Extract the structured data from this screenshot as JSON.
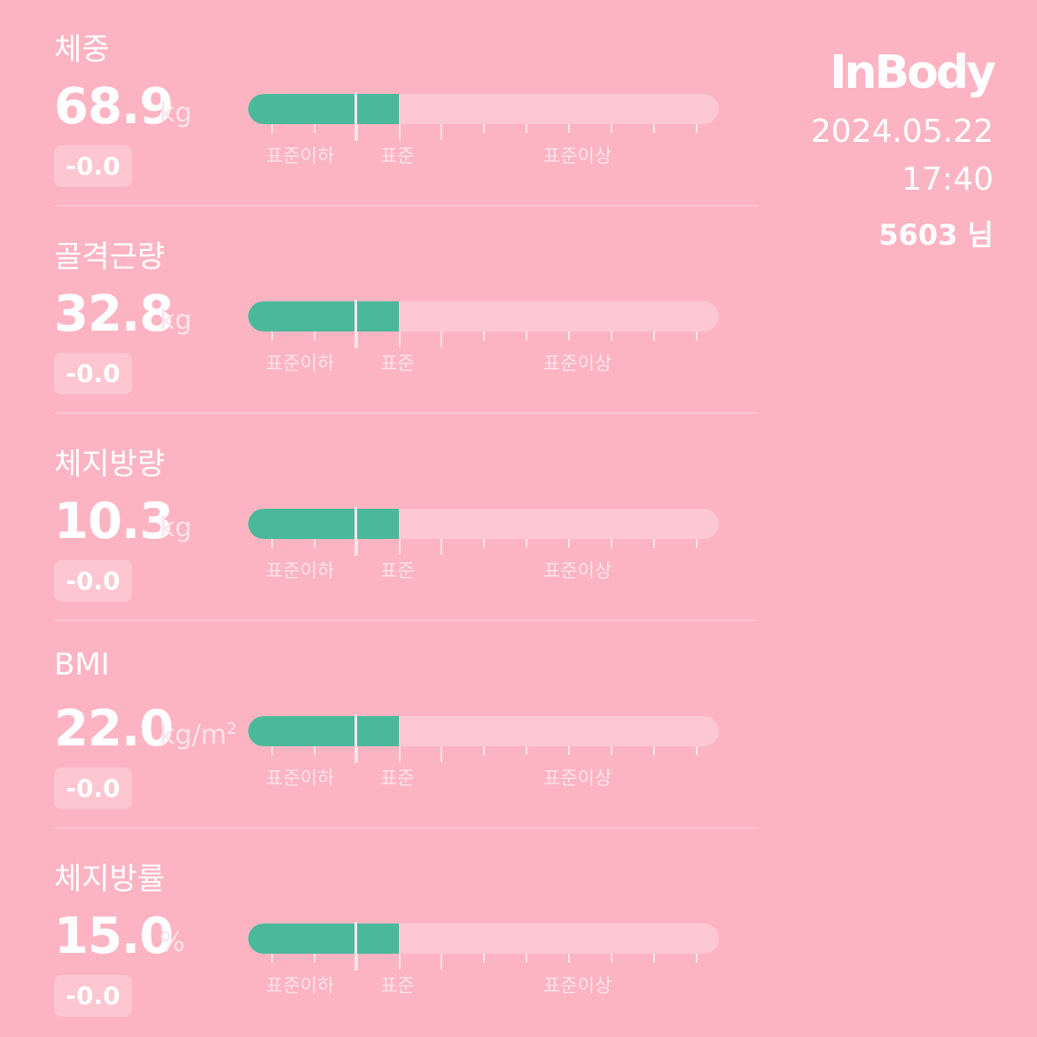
{
  "header": {
    "logo": "InBody",
    "date": "2024.05.22",
    "time": "17:40",
    "user": "5603 님"
  },
  "colors": {
    "background": "#fcb4c3",
    "bar_fill": "#49b99a",
    "bar_track": "#fdc8d2"
  },
  "range_labels": {
    "below": "표준이하",
    "normal": "표준",
    "above": "표준이상"
  },
  "metrics": [
    {
      "title": "체중",
      "value": "68.9",
      "unit": "kg",
      "unit_sup": "",
      "change": "-0.0",
      "level": 0.32
    },
    {
      "title": "골격근량",
      "value": "32.8",
      "unit": "kg",
      "unit_sup": "",
      "change": "-0.0",
      "level": 0.32
    },
    {
      "title": "체지방량",
      "value": "10.3",
      "unit": "kg",
      "unit_sup": "",
      "change": "-0.0",
      "level": 0.32
    },
    {
      "title": "BMI",
      "value": "22.0",
      "unit": "kg/m",
      "unit_sup": "2",
      "change": "-0.0",
      "level": 0.32
    },
    {
      "title": "체지방률",
      "value": "15.0",
      "unit": "%",
      "unit_sup": "",
      "change": "-0.0",
      "level": 0.32
    }
  ]
}
